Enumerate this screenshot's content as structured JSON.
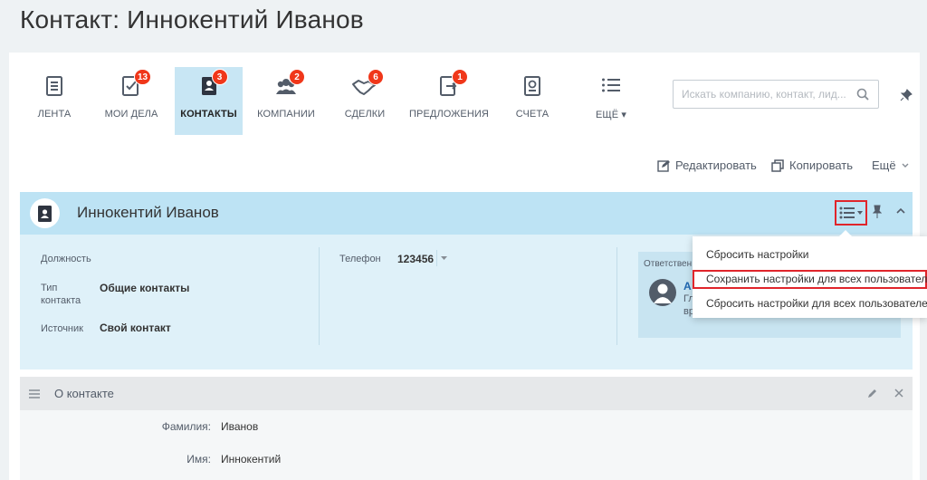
{
  "page": {
    "title": "Контакт: Иннокентий Иванов"
  },
  "toolbar": {
    "items": [
      {
        "label": "Лента",
        "badge": ""
      },
      {
        "label": "Мои дела",
        "badge": "13"
      },
      {
        "label": "Контакты",
        "badge": "3"
      },
      {
        "label": "Компании",
        "badge": "2"
      },
      {
        "label": "Сделки",
        "badge": "6"
      },
      {
        "label": "Предложения",
        "badge": "1"
      },
      {
        "label": "Счета",
        "badge": ""
      },
      {
        "label": "Ещё ▾",
        "badge": ""
      }
    ],
    "search_placeholder": "Искать компанию, контакт, лид..."
  },
  "actions": {
    "edit": "Редактировать",
    "copy": "Копировать",
    "more": "Ещё"
  },
  "contact": {
    "name": "Иннокентий Иванов",
    "fields": {
      "position_label": "Должность",
      "type_label_1": "Тип",
      "type_label_2": "контакта",
      "type_value": "Общие контакты",
      "source_label": "Источник",
      "source_value": "Свой контакт",
      "phone_label": "Телефон",
      "phone_value": "123456"
    },
    "responsible": {
      "label": "Ответствен",
      "initial": "А",
      "sub1": "Гл",
      "sub2": "вр"
    }
  },
  "popup": {
    "items": [
      "Сбросить настройки",
      "Сохранить настройки для всех пользователей",
      "Сбросить настройки для всех пользователей"
    ]
  },
  "about": {
    "title": "О контакте",
    "rows": [
      {
        "label": "Фамилия:",
        "value": "Иванов"
      },
      {
        "label": "Имя:",
        "value": "Иннокентий"
      }
    ]
  },
  "colors": {
    "accent_blue": "#2fc6f6",
    "badge_red": "#f0371a",
    "highlight_red": "#e0252b"
  }
}
